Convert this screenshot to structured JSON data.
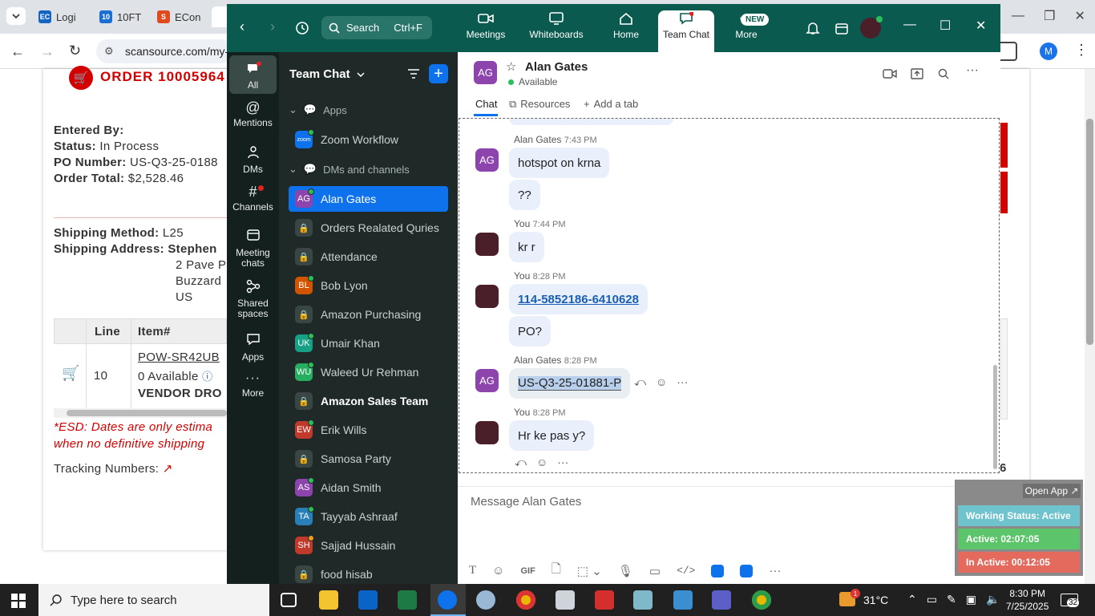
{
  "browser": {
    "tabs": [
      {
        "label": "Logi",
        "favicon": "EC"
      },
      {
        "label": "10FT",
        "favicon": "10"
      },
      {
        "label": "ECon",
        "favicon": "S"
      }
    ],
    "url": "scansource.com/my-",
    "profile_initial": "M"
  },
  "webpage": {
    "order_heading": "ORDER 10005964",
    "entered_by_label": "Entered By:",
    "status_label": "Status:",
    "status_value": "In Process",
    "po_label": "PO Number:",
    "po_value": "US-Q3-25-0188",
    "total_label": "Order Total:",
    "total_value": "$2,528.46",
    "ship_method_label": "Shipping Method:",
    "ship_method_value": "L25",
    "ship_address_label": "Shipping Address:",
    "ship_address_lines": [
      "Stephen",
      "2 Pave P",
      "Buzzard",
      "US"
    ],
    "table_headers": [
      "Line",
      "Item#"
    ],
    "row_line": "10",
    "row_item": "POW-SR42UB",
    "row_available": "0 Available",
    "row_vendor": "VENDOR DRO",
    "esd_note_1": "*ESD: Dates are only estima",
    "esd_note_2": "when no definitive shipping",
    "tracking_label": "Tracking Numbers:",
    "right_digit": "6"
  },
  "zoom": {
    "search_label": "Search",
    "search_shortcut": "Ctrl+F",
    "nav": [
      {
        "label": "Meetings"
      },
      {
        "label": "Whiteboards"
      },
      {
        "label": "Home"
      },
      {
        "label": "Team Chat"
      },
      {
        "label": "More",
        "badge": "NEW"
      }
    ],
    "rail": [
      {
        "label": "All"
      },
      {
        "label": "Mentions"
      },
      {
        "label": "DMs"
      },
      {
        "label": "Channels"
      },
      {
        "label": "Meeting chats"
      },
      {
        "label": "Shared spaces"
      },
      {
        "label": "Apps"
      },
      {
        "label": "More"
      }
    ],
    "list_title": "Team Chat",
    "apps_section": "Apps",
    "app_item": "Zoom Workflow",
    "app_logo": "zoom",
    "dm_section": "DMs and channels",
    "contacts": [
      {
        "initials": "AG",
        "name": "Alan Gates",
        "color": "#8e44ad"
      },
      {
        "initials": "",
        "name": "Orders Realated Quries",
        "color": ""
      },
      {
        "initials": "",
        "name": "Attendance",
        "color": ""
      },
      {
        "initials": "BL",
        "name": "Bob Lyon",
        "color": "#d35400"
      },
      {
        "initials": "",
        "name": "Amazon Purchasing",
        "color": ""
      },
      {
        "initials": "UK",
        "name": "Umair Khan",
        "color": "#16a085"
      },
      {
        "initials": "WU",
        "name": "Waleed Ur Rehman",
        "color": "#27ae60"
      },
      {
        "initials": "",
        "name": "Amazon Sales Team",
        "color": ""
      },
      {
        "initials": "EW",
        "name": "Erik Wills",
        "color": "#c0392b"
      },
      {
        "initials": "",
        "name": "Samosa Party",
        "color": ""
      },
      {
        "initials": "AS",
        "name": "Aidan Smith",
        "color": "#8e44ad"
      },
      {
        "initials": "TA",
        "name": "Tayyab Ashraaf",
        "color": "#2980b9"
      },
      {
        "initials": "SH",
        "name": "Sajjad Hussain",
        "color": "#c0392b"
      },
      {
        "initials": "",
        "name": "food hisab",
        "color": ""
      }
    ],
    "chat": {
      "contact_initials": "AG",
      "contact_name": "Alan Gates",
      "presence": "Available",
      "tabs": [
        "Chat",
        "Resources",
        "Add a tab"
      ],
      "messages": [
        {
          "sender": "Alan Gates",
          "time": "7:43 PM",
          "text": "hotspot on krna"
        },
        {
          "sender": "",
          "time": "",
          "text": "??"
        },
        {
          "sender": "You",
          "time": "7:44 PM",
          "text": "kr r"
        },
        {
          "sender": "You",
          "time": "8:28 PM",
          "text": "114-5852186-6410628"
        },
        {
          "sender": "",
          "time": "",
          "text": "PO?"
        },
        {
          "sender": "Alan Gates",
          "time": "8:28 PM",
          "text": "US-Q3-25-01881-P"
        },
        {
          "sender": "You",
          "time": "8:28 PM",
          "text": "Hr ke pas y?"
        }
      ],
      "compose_placeholder": "Message Alan Gates",
      "gif_label": "GIF"
    }
  },
  "widget": {
    "open_app": "Open App ↗",
    "working_status": "Working Status: Active",
    "active": "Active: 02:07:05",
    "inactive": "In Active: 00:12:05"
  },
  "taskbar": {
    "search_placeholder": "Type here to search",
    "temperature": "31°C",
    "time": "8:30 PM",
    "date": "7/25/2025",
    "notification_count": "32",
    "weather_badge": "1"
  },
  "colors": {
    "zoom_header": "#0b5a4f",
    "selected_item": "#0e72ed",
    "order_red": "#d40000",
    "widget_active_status": "#6ec3cc",
    "widget_active": "#5cc46a",
    "widget_inactive": "#e36a5d"
  }
}
